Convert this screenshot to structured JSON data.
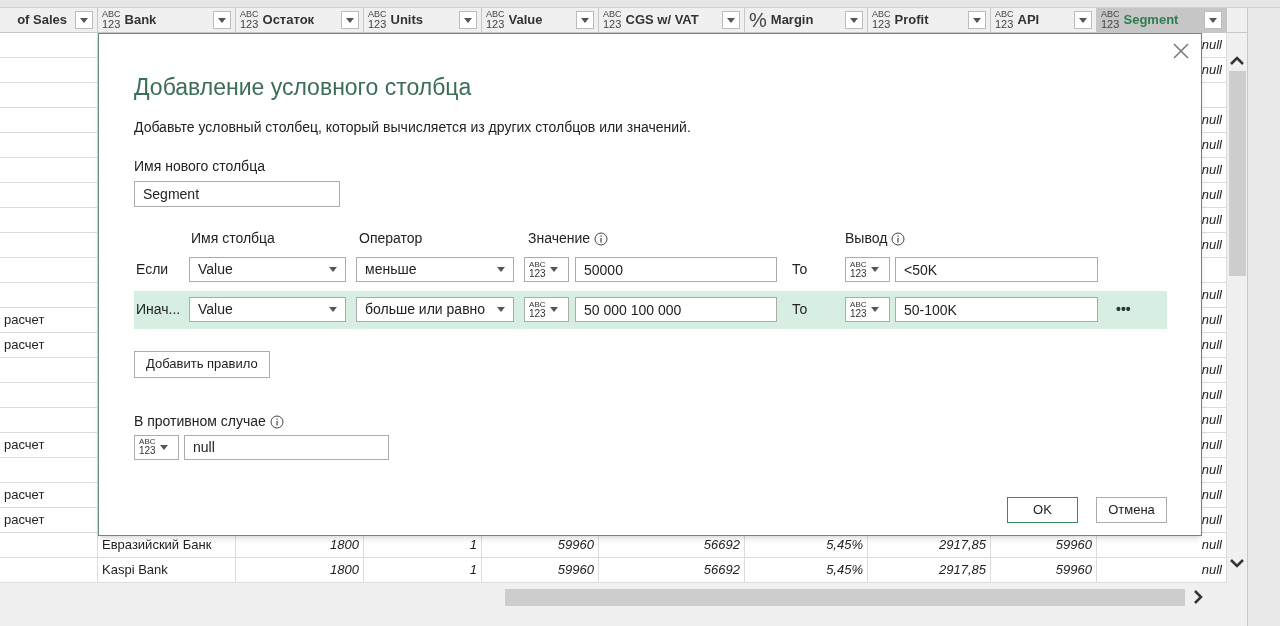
{
  "table": {
    "columns": [
      {
        "name": "of Sales",
        "selected": false
      },
      {
        "name": "Bank",
        "type": [
          "ABC",
          "123"
        ],
        "selected": false
      },
      {
        "name": "Остаток",
        "type": [
          "ABC",
          "123"
        ],
        "selected": false
      },
      {
        "name": "Units",
        "type": [
          "ABC",
          "123"
        ],
        "selected": false
      },
      {
        "name": "Value",
        "type": [
          "ABC",
          "123"
        ],
        "selected": false
      },
      {
        "name": "CGS w/ VAT",
        "type": [
          "ABC",
          "123"
        ],
        "selected": false
      },
      {
        "name": "Margin",
        "type": [
          "%"
        ],
        "selected": false
      },
      {
        "name": "Profit",
        "type": [
          "ABC",
          "123"
        ],
        "selected": false
      },
      {
        "name": "API",
        "type": [
          "ABC",
          "123"
        ],
        "selected": false
      },
      {
        "name": "Segment",
        "type": [
          "ABC",
          "123"
        ],
        "selected": true
      }
    ],
    "rows": [
      {
        "cells": [
          null,
          null,
          null,
          null,
          null,
          null,
          null,
          null,
          null,
          "null"
        ]
      },
      {
        "cells": [
          null,
          null,
          null,
          null,
          null,
          null,
          null,
          null,
          null,
          "null"
        ]
      },
      {
        "cells": [
          null,
          null,
          null,
          null,
          null,
          null,
          null,
          null,
          null,
          null
        ]
      },
      {
        "cells": [
          null,
          null,
          null,
          null,
          null,
          null,
          null,
          null,
          null,
          "null"
        ]
      },
      {
        "cells": [
          null,
          null,
          null,
          null,
          null,
          null,
          null,
          null,
          null,
          "null"
        ]
      },
      {
        "cells": [
          null,
          null,
          null,
          null,
          null,
          null,
          null,
          null,
          null,
          "null"
        ]
      },
      {
        "cells": [
          null,
          null,
          null,
          null,
          null,
          null,
          null,
          null,
          null,
          "null"
        ]
      },
      {
        "cells": [
          null,
          null,
          null,
          null,
          null,
          null,
          null,
          null,
          null,
          "null"
        ]
      },
      {
        "cells": [
          null,
          null,
          null,
          null,
          null,
          null,
          null,
          null,
          null,
          "null"
        ]
      },
      {
        "cells": [
          null,
          null,
          null,
          null,
          null,
          null,
          null,
          null,
          null,
          null
        ]
      },
      {
        "cells": [
          null,
          null,
          null,
          null,
          null,
          null,
          null,
          null,
          null,
          "null"
        ]
      },
      {
        "cells": [
          "расчет",
          null,
          null,
          null,
          null,
          null,
          null,
          null,
          null,
          "null"
        ]
      },
      {
        "cells": [
          "расчет",
          null,
          null,
          null,
          null,
          null,
          null,
          null,
          null,
          "null"
        ]
      },
      {
        "cells": [
          null,
          null,
          null,
          null,
          null,
          null,
          null,
          null,
          null,
          "null"
        ]
      },
      {
        "cells": [
          null,
          null,
          null,
          null,
          null,
          null,
          null,
          null,
          null,
          "null"
        ]
      },
      {
        "cells": [
          null,
          null,
          null,
          null,
          null,
          null,
          null,
          null,
          null,
          "null"
        ]
      },
      {
        "cells": [
          "расчет",
          null,
          null,
          null,
          null,
          null,
          null,
          null,
          null,
          "null"
        ]
      },
      {
        "cells": [
          null,
          null,
          null,
          null,
          null,
          null,
          null,
          null,
          null,
          "null"
        ]
      },
      {
        "cells": [
          "расчет",
          null,
          null,
          null,
          null,
          null,
          null,
          null,
          null,
          "null"
        ]
      },
      {
        "cells": [
          "расчет",
          null,
          null,
          null,
          null,
          null,
          null,
          null,
          null,
          "null"
        ]
      },
      {
        "cells": [
          null,
          "Евразийский Банк",
          "1800",
          "1",
          "59960",
          "56692",
          "5,45%",
          "2917,85",
          "59960",
          "null"
        ]
      },
      {
        "cells": [
          null,
          "Kaspi Bank",
          "1800",
          "1",
          "59960",
          "56692",
          "5,45%",
          "2917,85",
          "59960",
          "null"
        ]
      }
    ]
  },
  "dialog": {
    "title": "Добавление условного столбца",
    "description": "Добавьте условный столбец, который вычисляется из других столбцов или значений.",
    "name_label": "Имя нового столбца",
    "name_value": "Segment",
    "headers": [
      {
        "text": "Имя столбца",
        "info": false
      },
      {
        "text": "Оператор",
        "info": false
      },
      {
        "text": "Значение",
        "info": true
      },
      {
        "text": "Вывод",
        "info": true
      }
    ],
    "rules": [
      {
        "label": "Если",
        "column": "Value",
        "operator": "меньше",
        "value_type": [
          "ABC",
          "123"
        ],
        "value": "50000",
        "then": "То",
        "output_type": [
          "ABC",
          "123"
        ],
        "output": "<50K",
        "selected": false
      },
      {
        "label": "Инач...",
        "column": "Value",
        "operator": "больше или равно",
        "value_type": [
          "ABC",
          "123"
        ],
        "value": "50 000 100 000",
        "then": "То",
        "output_type": [
          "ABC",
          "123"
        ],
        "output": "50-100K",
        "selected": true,
        "menu": "•••"
      }
    ],
    "add_rule": "Добавить правило",
    "else_label": "В противном случае",
    "else_type": [
      "ABC",
      "123"
    ],
    "else_value": "null",
    "ok": "OK",
    "cancel": "Отмена"
  }
}
